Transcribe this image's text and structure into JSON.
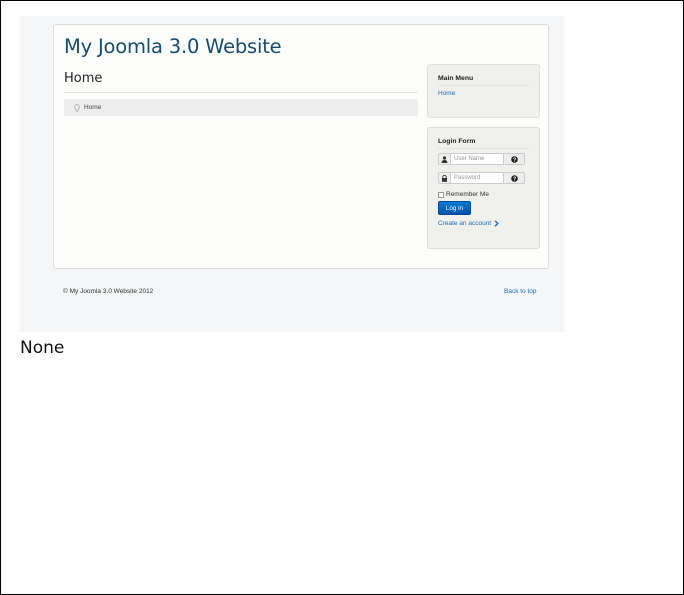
{
  "site": {
    "title": "My Joomla 3.0 Website"
  },
  "page": {
    "heading": "Home"
  },
  "breadcrumb": {
    "icon": "location-pin-icon",
    "items": [
      "Home"
    ]
  },
  "main_menu": {
    "title": "Main Menu",
    "items": [
      "Home"
    ]
  },
  "login_form": {
    "title": "Login Form",
    "username": {
      "placeholder": "User Name",
      "icon": "user-icon",
      "help_icon": "help-icon"
    },
    "password": {
      "placeholder": "Password",
      "icon": "lock-icon",
      "help_icon": "help-icon"
    },
    "remember_label": "Remember Me",
    "remember_checked": false,
    "submit_label": "Log in",
    "create_account_label": "Create an account",
    "accent_color": "#0a6fcc"
  },
  "footer": {
    "copyright": "© My Joomla 3.0 Website 2012",
    "back_to_top": "Back to top"
  },
  "caption": "None",
  "colors": {
    "title": "#124d72",
    "link": "#1b6fb8",
    "background": "#f4f6f7"
  }
}
